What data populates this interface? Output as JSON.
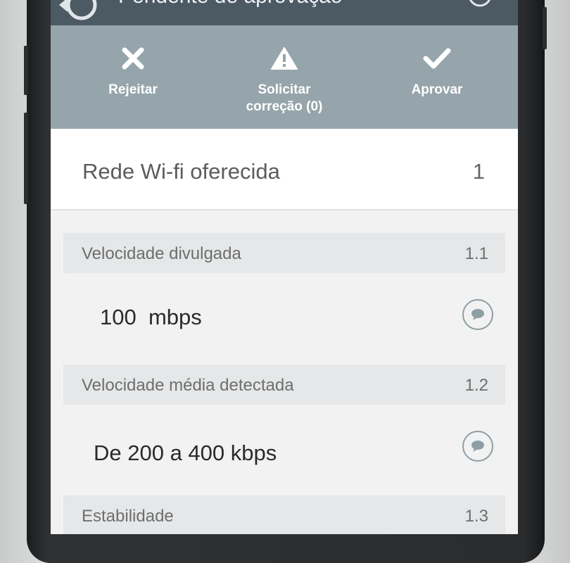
{
  "header": {
    "title": "Pendente de aprovação",
    "back_icon": "back-refresh-icon",
    "help_icon": "help-icon"
  },
  "actions": [
    {
      "label": "Rejeitar",
      "icon": "close-icon"
    },
    {
      "label_line1": "Solicitar",
      "label_line2": "correção (0)",
      "icon": "warning-icon"
    },
    {
      "label": "Aprovar",
      "icon": "check-icon"
    }
  ],
  "section": {
    "title": "Rede Wi-fi oferecida",
    "number": "1"
  },
  "items": [
    {
      "label": "Velocidade divulgada",
      "number": "1.1",
      "value": "100  mbps",
      "comment_icon": "comment-icon"
    },
    {
      "label": "Velocidade média detectada",
      "number": "1.2",
      "value": "De 200 a 400 kbps",
      "comment_icon": "comment-icon"
    },
    {
      "label": "Estabilidade",
      "number": "1.3"
    }
  ],
  "colors": {
    "titlebar": "#4b5a63",
    "actionbar": "#96a5ab",
    "subheader": "#e5e7e8",
    "icon_outline": "#8e9ea5"
  }
}
